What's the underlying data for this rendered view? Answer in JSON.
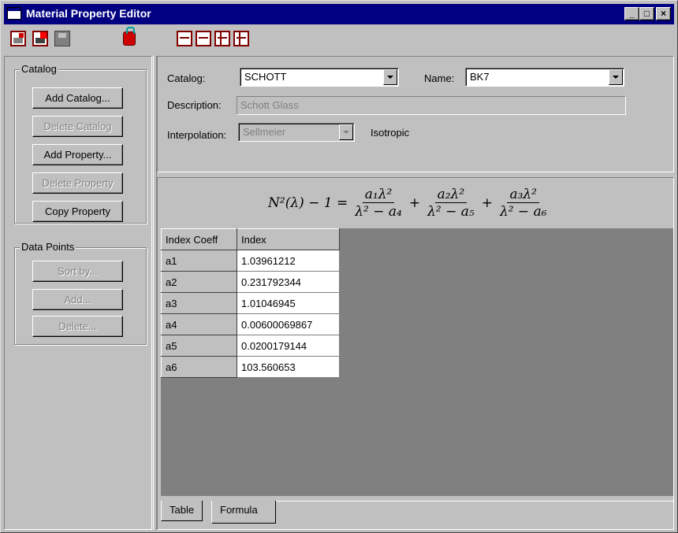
{
  "window": {
    "title": "Material Property Editor",
    "controls": [
      "_",
      "□",
      "×"
    ]
  },
  "toolbar": {
    "icons": [
      "open-catalog-icon",
      "open-file-icon",
      "save-icon",
      "lock-icon",
      "insert-row-icon",
      "delete-row-icon",
      "move-down-icon",
      "move-up-icon"
    ]
  },
  "catalog_group": {
    "title": "Catalog",
    "add_catalog": "Add Catalog...",
    "delete_catalog": "Delete Catalog",
    "add_property": "Add  Property...",
    "delete_property": "Delete Property",
    "copy_property": "Copy Property"
  },
  "data_points_group": {
    "title": "Data Points",
    "sort_by": "Sort by...",
    "add": "Add...",
    "delete": "Delete..."
  },
  "properties": {
    "catalog_label": "Catalog:",
    "catalog_value": "SCHOTT",
    "name_label": "Name:",
    "name_value": "BK7",
    "description_label": "Description:",
    "description_value": "Schott Glass",
    "interpolation_label": "Interpolation:",
    "interpolation_value": "Sellmeier",
    "isotropy": "Isotropic"
  },
  "formula": {
    "lhs": "N²(λ) − 1 =",
    "terms": [
      {
        "num": "a₁λ²",
        "den": "λ² − a₄"
      },
      {
        "num": "a₂λ²",
        "den": "λ² − a₅"
      },
      {
        "num": "a₃λ²",
        "den": "λ² − a₆"
      }
    ],
    "plus": "+"
  },
  "table": {
    "headers": [
      "Index Coeff",
      "Index"
    ],
    "rows": [
      [
        "a1",
        "1.03961212"
      ],
      [
        "a2",
        "0.231792344"
      ],
      [
        "a3",
        "1.01046945"
      ],
      [
        "a4",
        "0.00600069867"
      ],
      [
        "a5",
        "0.0200179144"
      ],
      [
        "a6",
        "103.560653"
      ]
    ]
  },
  "tabs": [
    "Table",
    "Formula"
  ]
}
